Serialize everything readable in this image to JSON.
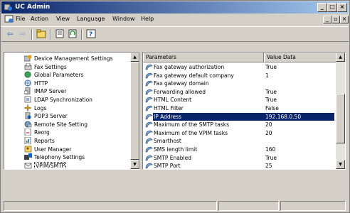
{
  "window": {
    "title": "UC Admin",
    "buttons": [
      "_",
      "□",
      "×"
    ]
  },
  "menubar": {
    "items": [
      "File",
      "Action",
      "View",
      "Language",
      "Window",
      "Help"
    ],
    "mdi_buttons": [
      "_",
      "▫",
      "×"
    ]
  },
  "toolbar": {
    "icons": [
      "back-arrow-icon",
      "forward-arrow-icon",
      "up-folder-icon",
      "properties-icon",
      "refresh-icon",
      "help-icon"
    ]
  },
  "tree": {
    "items": [
      {
        "label": "Device Management Settings",
        "icon": "device-settings-icon"
      },
      {
        "label": "Fax Settings",
        "icon": "fax-icon"
      },
      {
        "label": "Global Parameters",
        "icon": "globe-icon"
      },
      {
        "label": "HTTP",
        "icon": "http-icon"
      },
      {
        "label": "IMAP Server",
        "icon": "imap-server-icon"
      },
      {
        "label": "LDAP Synchronization",
        "icon": "ldap-icon"
      },
      {
        "label": "Logs",
        "icon": "logs-icon"
      },
      {
        "label": "POP3 Server",
        "icon": "pop3-server-icon"
      },
      {
        "label": "Remote Site Setting",
        "icon": "remote-site-icon"
      },
      {
        "label": "Reorg",
        "icon": "reorg-icon"
      },
      {
        "label": "Reports",
        "icon": "reports-icon"
      },
      {
        "label": "User Manager",
        "icon": "user-manager-icon"
      },
      {
        "label": "Telephony Settings",
        "icon": "telephony-icon"
      },
      {
        "label": "VPIM/SMTP",
        "icon": "vpim-smtp-icon"
      }
    ],
    "selected_index": 13
  },
  "parameters": {
    "columns": [
      "Parameters",
      "Value Data"
    ],
    "rows": [
      {
        "name": "Fax gateway authorization",
        "value": "True"
      },
      {
        "name": "Fax gateway default company",
        "value": "1"
      },
      {
        "name": "Fax gateway domain",
        "value": ""
      },
      {
        "name": "Forwarding allowed",
        "value": "True"
      },
      {
        "name": "HTML Content",
        "value": "True"
      },
      {
        "name": "HTML Filter",
        "value": "False"
      },
      {
        "name": "IP Address",
        "value": "192.168.0.50"
      },
      {
        "name": "Maximum of the SMTP tasks",
        "value": "20"
      },
      {
        "name": "Maximum of the VPIM tasks",
        "value": "20"
      },
      {
        "name": "Smarthost",
        "value": ""
      },
      {
        "name": "SMS length limit",
        "value": "160"
      },
      {
        "name": "SMTP Enabled",
        "value": "True"
      },
      {
        "name": "SMTP Port",
        "value": "25"
      }
    ],
    "selected_index": 6
  },
  "colors": {
    "selection": "#0a246a",
    "face": "#d4d0c8",
    "title_start": "#0a246a",
    "title_end": "#a6caf0"
  }
}
